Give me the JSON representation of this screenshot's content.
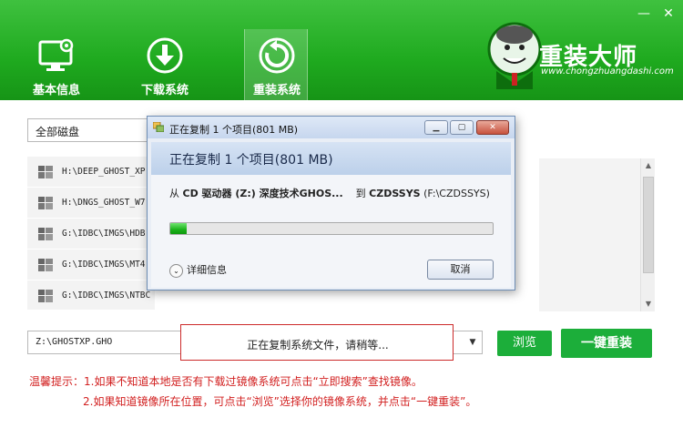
{
  "window": {
    "minimize_glyph": "—",
    "close_glyph": "✕"
  },
  "nav": [
    {
      "label": "基本信息",
      "icon": "monitor-gear-icon"
    },
    {
      "label": "下载系统",
      "icon": "download-icon"
    },
    {
      "label": "重装系统",
      "icon": "reinstall-icon",
      "active": true
    }
  ],
  "brand": {
    "title": "重装大师",
    "url": "www.chongzhuangdashi.com"
  },
  "disk_select": {
    "value": "全部磁盘"
  },
  "image_list": [
    {
      "path": "H:\\DEEP_GHOST_XP"
    },
    {
      "path": "H:\\DNGS_GHOST_W7"
    },
    {
      "path": "G:\\IDBC\\IMGS\\HDB"
    },
    {
      "path": "G:\\IDBC\\IMGS\\MT4"
    },
    {
      "path": "G:\\IDBC\\IMGS\\NTBC"
    }
  ],
  "path_input": {
    "value": "Z:\\GHOSTXP.GHO"
  },
  "status": "正在复制系统文件，请稍等...",
  "buttons": {
    "browse": "浏览",
    "reinstall": "一键重装"
  },
  "tips": {
    "line1": "温馨提示：1.如果不知道本地是否有下载过镜像系统可点击“立即搜索”查找镜像。",
    "line2": "2.如果知道镜像所在位置，可点击“浏览”选择你的镜像系统，并点击“一键重装”。"
  },
  "dialog": {
    "title": "正在复制 1 个项目(801 MB)",
    "heading": "正在复制 1 个项目(801 MB)",
    "from_prefix": "从",
    "from_source": "CD 驱动器 (Z:) 深度技术GHOS...",
    "to_prefix": "到",
    "to_dest": "CZDSSYS",
    "to_dest_path": "(F:\\CZDSSYS)",
    "progress": 0.05,
    "details": "详细信息",
    "cancel": "取消"
  },
  "colors": {
    "header": "#1faa1f",
    "button": "#1cae3a",
    "tip": "#d22020",
    "status_border": "#cc2a2a"
  }
}
